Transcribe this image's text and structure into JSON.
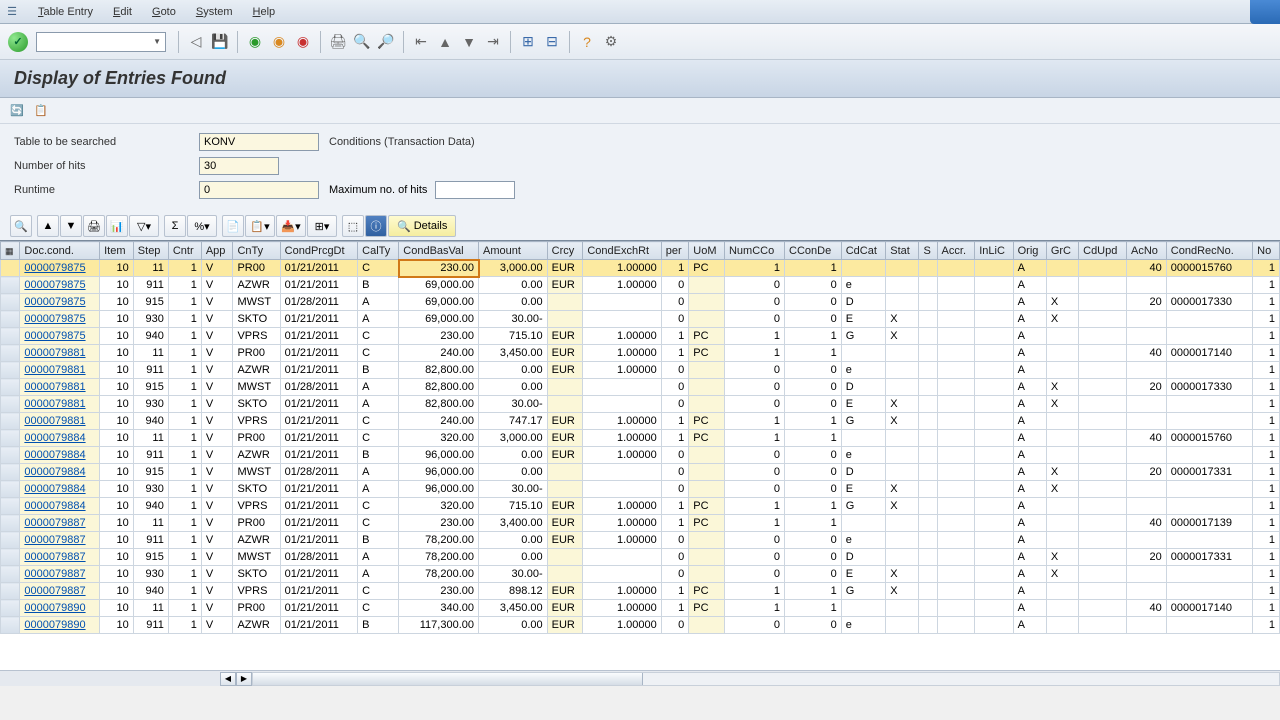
{
  "menu": {
    "items": [
      "Table Entry",
      "Edit",
      "Goto",
      "System",
      "Help"
    ]
  },
  "title": "Display of Entries Found",
  "search": {
    "table_label": "Table to be searched",
    "table_value": "KONV",
    "table_desc": "Conditions (Transaction Data)",
    "hits_label": "Number of hits",
    "hits_value": "30",
    "runtime_label": "Runtime",
    "runtime_value": "0",
    "max_label": "Maximum no. of hits",
    "max_value": ""
  },
  "details_label": "Details",
  "columns": [
    "",
    "Doc.cond.",
    "Item",
    "Step",
    "Cntr",
    "App",
    "CnTy",
    "CondPrcgDt",
    "CalTy",
    "CondBasVal",
    "Amount",
    "Crcy",
    "CondExchRt",
    "per",
    "UoM",
    "NumCCo",
    "CConDe",
    "CdCat",
    "Stat",
    "S",
    "Accr.",
    "InLiC",
    "Orig",
    "GrC",
    "CdUpd",
    "AcNo",
    "CondRecNo.",
    "No"
  ],
  "rows": [
    {
      "doc": "0000079875",
      "item": "10",
      "step": "11",
      "cntr": "1",
      "app": "V",
      "cnty": "PR00",
      "dt": "01/21/2011",
      "calty": "C",
      "bas": "230.00",
      "amt": "3,000.00",
      "crcy": "EUR",
      "ex": "1.00000",
      "per": "1",
      "uom": "PC",
      "num": "1",
      "ccon": "1",
      "cdcat": "",
      "stat": "",
      "s": "",
      "accr": "",
      "inlic": "",
      "orig": "A",
      "grc": "",
      "cdupd": "",
      "acno": "40",
      "rec": "0000015760",
      "no": "1",
      "sel": true
    },
    {
      "doc": "0000079875",
      "item": "10",
      "step": "911",
      "cntr": "1",
      "app": "V",
      "cnty": "AZWR",
      "dt": "01/21/2011",
      "calty": "B",
      "bas": "69,000.00",
      "amt": "0.00",
      "crcy": "EUR",
      "ex": "1.00000",
      "per": "0",
      "uom": "",
      "num": "0",
      "ccon": "0",
      "cdcat": "e",
      "stat": "",
      "s": "",
      "accr": "",
      "inlic": "",
      "orig": "A",
      "grc": "",
      "cdupd": "",
      "acno": "",
      "rec": "",
      "no": "1"
    },
    {
      "doc": "0000079875",
      "item": "10",
      "step": "915",
      "cntr": "1",
      "app": "V",
      "cnty": "MWST",
      "dt": "01/28/2011",
      "calty": "A",
      "bas": "69,000.00",
      "amt": "0.00",
      "crcy": "",
      "ex": "",
      "per": "0",
      "uom": "",
      "num": "0",
      "ccon": "0",
      "cdcat": "D",
      "stat": "",
      "s": "",
      "accr": "",
      "inlic": "",
      "orig": "A",
      "grc": "X",
      "cdupd": "",
      "acno": "20",
      "rec": "0000017330",
      "no": "1"
    },
    {
      "doc": "0000079875",
      "item": "10",
      "step": "930",
      "cntr": "1",
      "app": "V",
      "cnty": "SKTO",
      "dt": "01/21/2011",
      "calty": "A",
      "bas": "69,000.00",
      "amt": "30.00-",
      "crcy": "",
      "ex": "",
      "per": "0",
      "uom": "",
      "num": "0",
      "ccon": "0",
      "cdcat": "E",
      "stat": "X",
      "s": "",
      "accr": "",
      "inlic": "",
      "orig": "A",
      "grc": "X",
      "cdupd": "",
      "acno": "",
      "rec": "",
      "no": "1"
    },
    {
      "doc": "0000079875",
      "item": "10",
      "step": "940",
      "cntr": "1",
      "app": "V",
      "cnty": "VPRS",
      "dt": "01/21/2011",
      "calty": "C",
      "bas": "230.00",
      "amt": "715.10",
      "crcy": "EUR",
      "ex": "1.00000",
      "per": "1",
      "uom": "PC",
      "num": "1",
      "ccon": "1",
      "cdcat": "G",
      "stat": "X",
      "s": "",
      "accr": "",
      "inlic": "",
      "orig": "A",
      "grc": "",
      "cdupd": "",
      "acno": "",
      "rec": "",
      "no": "1"
    },
    {
      "doc": "0000079881",
      "item": "10",
      "step": "11",
      "cntr": "1",
      "app": "V",
      "cnty": "PR00",
      "dt": "01/21/2011",
      "calty": "C",
      "bas": "240.00",
      "amt": "3,450.00",
      "crcy": "EUR",
      "ex": "1.00000",
      "per": "1",
      "uom": "PC",
      "num": "1",
      "ccon": "1",
      "cdcat": "",
      "stat": "",
      "s": "",
      "accr": "",
      "inlic": "",
      "orig": "A",
      "grc": "",
      "cdupd": "",
      "acno": "40",
      "rec": "0000017140",
      "no": "1"
    },
    {
      "doc": "0000079881",
      "item": "10",
      "step": "911",
      "cntr": "1",
      "app": "V",
      "cnty": "AZWR",
      "dt": "01/21/2011",
      "calty": "B",
      "bas": "82,800.00",
      "amt": "0.00",
      "crcy": "EUR",
      "ex": "1.00000",
      "per": "0",
      "uom": "",
      "num": "0",
      "ccon": "0",
      "cdcat": "e",
      "stat": "",
      "s": "",
      "accr": "",
      "inlic": "",
      "orig": "A",
      "grc": "",
      "cdupd": "",
      "acno": "",
      "rec": "",
      "no": "1"
    },
    {
      "doc": "0000079881",
      "item": "10",
      "step": "915",
      "cntr": "1",
      "app": "V",
      "cnty": "MWST",
      "dt": "01/28/2011",
      "calty": "A",
      "bas": "82,800.00",
      "amt": "0.00",
      "crcy": "",
      "ex": "",
      "per": "0",
      "uom": "",
      "num": "0",
      "ccon": "0",
      "cdcat": "D",
      "stat": "",
      "s": "",
      "accr": "",
      "inlic": "",
      "orig": "A",
      "grc": "X",
      "cdupd": "",
      "acno": "20",
      "rec": "0000017330",
      "no": "1"
    },
    {
      "doc": "0000079881",
      "item": "10",
      "step": "930",
      "cntr": "1",
      "app": "V",
      "cnty": "SKTO",
      "dt": "01/21/2011",
      "calty": "A",
      "bas": "82,800.00",
      "amt": "30.00-",
      "crcy": "",
      "ex": "",
      "per": "0",
      "uom": "",
      "num": "0",
      "ccon": "0",
      "cdcat": "E",
      "stat": "X",
      "s": "",
      "accr": "",
      "inlic": "",
      "orig": "A",
      "grc": "X",
      "cdupd": "",
      "acno": "",
      "rec": "",
      "no": "1"
    },
    {
      "doc": "0000079881",
      "item": "10",
      "step": "940",
      "cntr": "1",
      "app": "V",
      "cnty": "VPRS",
      "dt": "01/21/2011",
      "calty": "C",
      "bas": "240.00",
      "amt": "747.17",
      "crcy": "EUR",
      "ex": "1.00000",
      "per": "1",
      "uom": "PC",
      "num": "1",
      "ccon": "1",
      "cdcat": "G",
      "stat": "X",
      "s": "",
      "accr": "",
      "inlic": "",
      "orig": "A",
      "grc": "",
      "cdupd": "",
      "acno": "",
      "rec": "",
      "no": "1"
    },
    {
      "doc": "0000079884",
      "item": "10",
      "step": "11",
      "cntr": "1",
      "app": "V",
      "cnty": "PR00",
      "dt": "01/21/2011",
      "calty": "C",
      "bas": "320.00",
      "amt": "3,000.00",
      "crcy": "EUR",
      "ex": "1.00000",
      "per": "1",
      "uom": "PC",
      "num": "1",
      "ccon": "1",
      "cdcat": "",
      "stat": "",
      "s": "",
      "accr": "",
      "inlic": "",
      "orig": "A",
      "grc": "",
      "cdupd": "",
      "acno": "40",
      "rec": "0000015760",
      "no": "1"
    },
    {
      "doc": "0000079884",
      "item": "10",
      "step": "911",
      "cntr": "1",
      "app": "V",
      "cnty": "AZWR",
      "dt": "01/21/2011",
      "calty": "B",
      "bas": "96,000.00",
      "amt": "0.00",
      "crcy": "EUR",
      "ex": "1.00000",
      "per": "0",
      "uom": "",
      "num": "0",
      "ccon": "0",
      "cdcat": "e",
      "stat": "",
      "s": "",
      "accr": "",
      "inlic": "",
      "orig": "A",
      "grc": "",
      "cdupd": "",
      "acno": "",
      "rec": "",
      "no": "1"
    },
    {
      "doc": "0000079884",
      "item": "10",
      "step": "915",
      "cntr": "1",
      "app": "V",
      "cnty": "MWST",
      "dt": "01/28/2011",
      "calty": "A",
      "bas": "96,000.00",
      "amt": "0.00",
      "crcy": "",
      "ex": "",
      "per": "0",
      "uom": "",
      "num": "0",
      "ccon": "0",
      "cdcat": "D",
      "stat": "",
      "s": "",
      "accr": "",
      "inlic": "",
      "orig": "A",
      "grc": "X",
      "cdupd": "",
      "acno": "20",
      "rec": "0000017331",
      "no": "1"
    },
    {
      "doc": "0000079884",
      "item": "10",
      "step": "930",
      "cntr": "1",
      "app": "V",
      "cnty": "SKTO",
      "dt": "01/21/2011",
      "calty": "A",
      "bas": "96,000.00",
      "amt": "30.00-",
      "crcy": "",
      "ex": "",
      "per": "0",
      "uom": "",
      "num": "0",
      "ccon": "0",
      "cdcat": "E",
      "stat": "X",
      "s": "",
      "accr": "",
      "inlic": "",
      "orig": "A",
      "grc": "X",
      "cdupd": "",
      "acno": "",
      "rec": "",
      "no": "1"
    },
    {
      "doc": "0000079884",
      "item": "10",
      "step": "940",
      "cntr": "1",
      "app": "V",
      "cnty": "VPRS",
      "dt": "01/21/2011",
      "calty": "C",
      "bas": "320.00",
      "amt": "715.10",
      "crcy": "EUR",
      "ex": "1.00000",
      "per": "1",
      "uom": "PC",
      "num": "1",
      "ccon": "1",
      "cdcat": "G",
      "stat": "X",
      "s": "",
      "accr": "",
      "inlic": "",
      "orig": "A",
      "grc": "",
      "cdupd": "",
      "acno": "",
      "rec": "",
      "no": "1"
    },
    {
      "doc": "0000079887",
      "item": "10",
      "step": "11",
      "cntr": "1",
      "app": "V",
      "cnty": "PR00",
      "dt": "01/21/2011",
      "calty": "C",
      "bas": "230.00",
      "amt": "3,400.00",
      "crcy": "EUR",
      "ex": "1.00000",
      "per": "1",
      "uom": "PC",
      "num": "1",
      "ccon": "1",
      "cdcat": "",
      "stat": "",
      "s": "",
      "accr": "",
      "inlic": "",
      "orig": "A",
      "grc": "",
      "cdupd": "",
      "acno": "40",
      "rec": "0000017139",
      "no": "1"
    },
    {
      "doc": "0000079887",
      "item": "10",
      "step": "911",
      "cntr": "1",
      "app": "V",
      "cnty": "AZWR",
      "dt": "01/21/2011",
      "calty": "B",
      "bas": "78,200.00",
      "amt": "0.00",
      "crcy": "EUR",
      "ex": "1.00000",
      "per": "0",
      "uom": "",
      "num": "0",
      "ccon": "0",
      "cdcat": "e",
      "stat": "",
      "s": "",
      "accr": "",
      "inlic": "",
      "orig": "A",
      "grc": "",
      "cdupd": "",
      "acno": "",
      "rec": "",
      "no": "1"
    },
    {
      "doc": "0000079887",
      "item": "10",
      "step": "915",
      "cntr": "1",
      "app": "V",
      "cnty": "MWST",
      "dt": "01/28/2011",
      "calty": "A",
      "bas": "78,200.00",
      "amt": "0.00",
      "crcy": "",
      "ex": "",
      "per": "0",
      "uom": "",
      "num": "0",
      "ccon": "0",
      "cdcat": "D",
      "stat": "",
      "s": "",
      "accr": "",
      "inlic": "",
      "orig": "A",
      "grc": "X",
      "cdupd": "",
      "acno": "20",
      "rec": "0000017331",
      "no": "1"
    },
    {
      "doc": "0000079887",
      "item": "10",
      "step": "930",
      "cntr": "1",
      "app": "V",
      "cnty": "SKTO",
      "dt": "01/21/2011",
      "calty": "A",
      "bas": "78,200.00",
      "amt": "30.00-",
      "crcy": "",
      "ex": "",
      "per": "0",
      "uom": "",
      "num": "0",
      "ccon": "0",
      "cdcat": "E",
      "stat": "X",
      "s": "",
      "accr": "",
      "inlic": "",
      "orig": "A",
      "grc": "X",
      "cdupd": "",
      "acno": "",
      "rec": "",
      "no": "1"
    },
    {
      "doc": "0000079887",
      "item": "10",
      "step": "940",
      "cntr": "1",
      "app": "V",
      "cnty": "VPRS",
      "dt": "01/21/2011",
      "calty": "C",
      "bas": "230.00",
      "amt": "898.12",
      "crcy": "EUR",
      "ex": "1.00000",
      "per": "1",
      "uom": "PC",
      "num": "1",
      "ccon": "1",
      "cdcat": "G",
      "stat": "X",
      "s": "",
      "accr": "",
      "inlic": "",
      "orig": "A",
      "grc": "",
      "cdupd": "",
      "acno": "",
      "rec": "",
      "no": "1"
    },
    {
      "doc": "0000079890",
      "item": "10",
      "step": "11",
      "cntr": "1",
      "app": "V",
      "cnty": "PR00",
      "dt": "01/21/2011",
      "calty": "C",
      "bas": "340.00",
      "amt": "3,450.00",
      "crcy": "EUR",
      "ex": "1.00000",
      "per": "1",
      "uom": "PC",
      "num": "1",
      "ccon": "1",
      "cdcat": "",
      "stat": "",
      "s": "",
      "accr": "",
      "inlic": "",
      "orig": "A",
      "grc": "",
      "cdupd": "",
      "acno": "40",
      "rec": "0000017140",
      "no": "1"
    },
    {
      "doc": "0000079890",
      "item": "10",
      "step": "911",
      "cntr": "1",
      "app": "V",
      "cnty": "AZWR",
      "dt": "01/21/2011",
      "calty": "B",
      "bas": "117,300.00",
      "amt": "0.00",
      "crcy": "EUR",
      "ex": "1.00000",
      "per": "0",
      "uom": "",
      "num": "0",
      "ccon": "0",
      "cdcat": "e",
      "stat": "",
      "s": "",
      "accr": "",
      "inlic": "",
      "orig": "A",
      "grc": "",
      "cdupd": "",
      "acno": "",
      "rec": "",
      "no": "1"
    }
  ]
}
